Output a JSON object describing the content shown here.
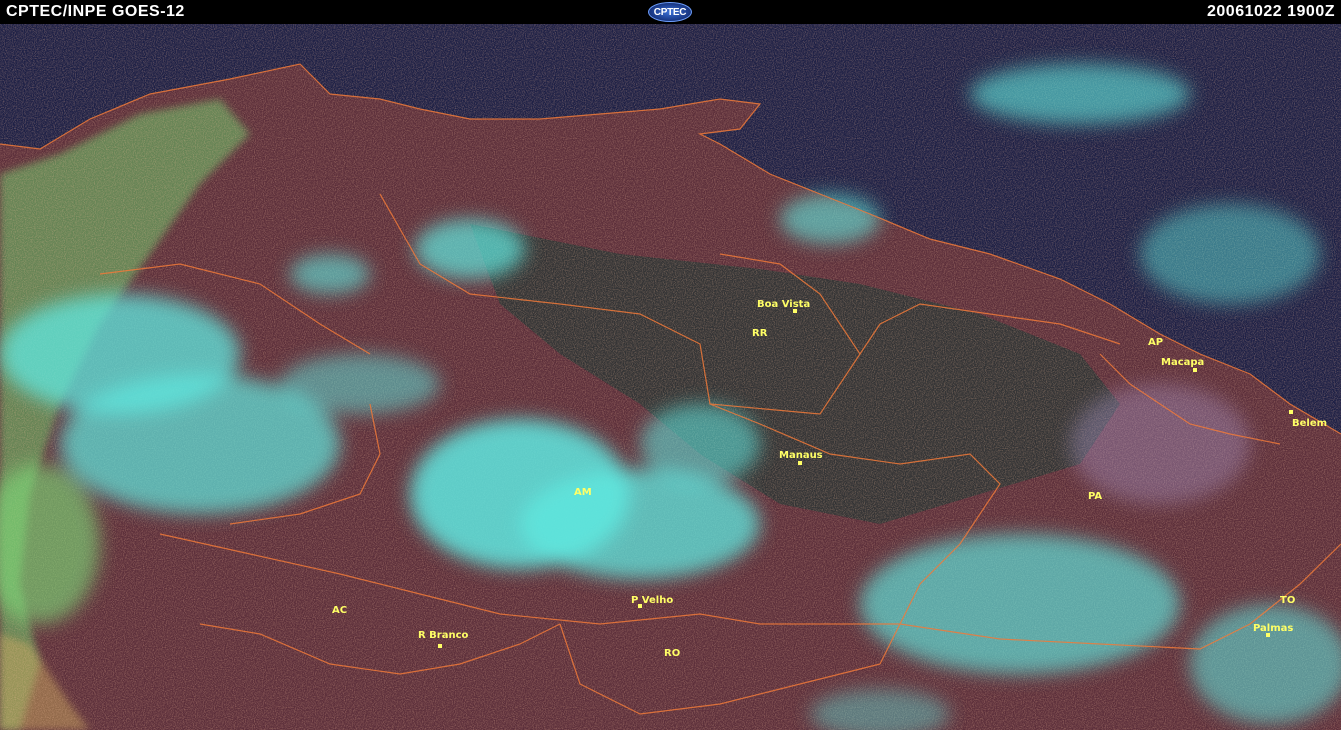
{
  "header": {
    "left_title": "CPTEC/INPE  GOES-12",
    "logo_text": "CPTEC",
    "timestamp": "20061022  1900Z"
  },
  "map": {
    "cities": [
      {
        "name": "Boa Vista",
        "lon": -60.67,
        "lat": 2.82
      },
      {
        "name": "Macapa",
        "lon": -51.07,
        "lat": 0.03
      },
      {
        "name": "Belem",
        "lon": -48.5,
        "lat": -1.45
      },
      {
        "name": "Manaus",
        "lon": -60.02,
        "lat": -3.1
      },
      {
        "name": "P Velho",
        "lon": -63.9,
        "lat": -8.76
      },
      {
        "name": "R Branco",
        "lon": -67.81,
        "lat": -9.97
      },
      {
        "name": "Palmas",
        "lon": -48.33,
        "lat": -10.18
      }
    ],
    "states": [
      "RR",
      "AP",
      "AM",
      "PA",
      "AC",
      "RO",
      "TO"
    ],
    "colors": {
      "ocean": "#1c1f45",
      "land_warm": "#6a2f3a",
      "land_dark": "#2a3334",
      "cloud_cyan": "#5fe8e0",
      "cloud_green": "#7ee07a",
      "border": "#f07a3a",
      "label": "#ffff66"
    }
  }
}
